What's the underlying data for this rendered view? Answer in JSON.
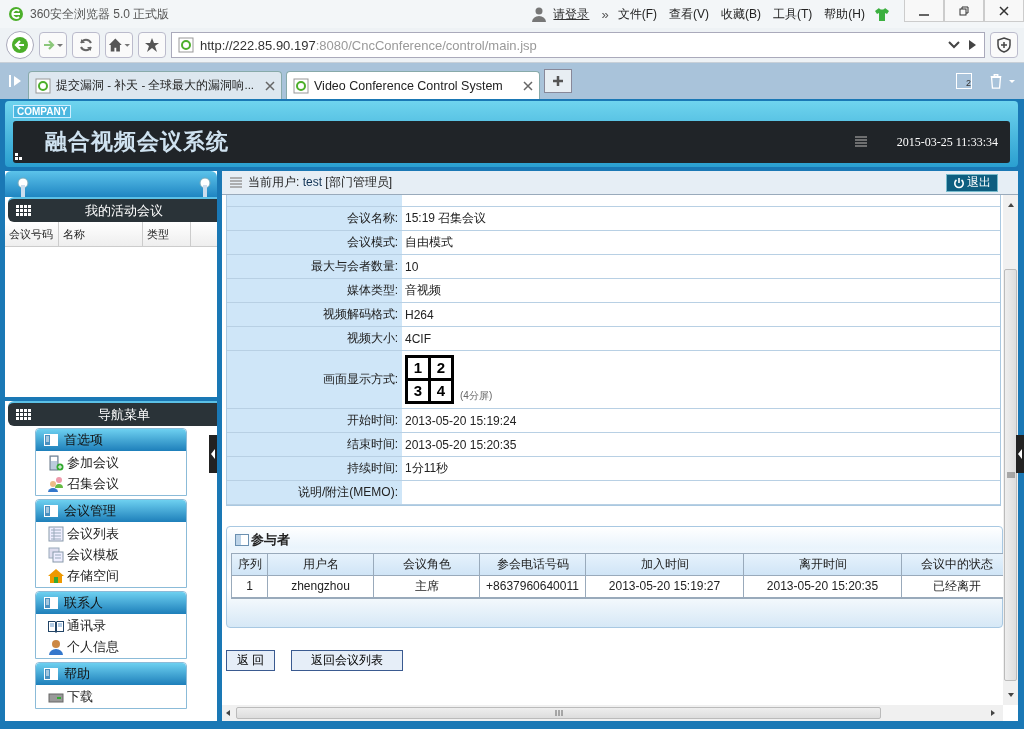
{
  "browser": {
    "title": "360安全浏览器 5.0 正式版",
    "login": "请登录",
    "more": "»",
    "menus": [
      "文件(F)",
      "查看(V)",
      "收藏(B)",
      "工具(T)",
      "帮助(H)"
    ],
    "url_host": "http://222.85.90.197",
    "url_rest": ":8080/CncConference/control/main.jsp",
    "tabs": [
      {
        "label": "提交漏洞 - 补天 - 全球最大的漏洞响...",
        "selected": false
      },
      {
        "label": "Video Conference Control System",
        "selected": true
      }
    ],
    "window_count": "2"
  },
  "app": {
    "company": "COMPANY",
    "title": "融合视频会议系统",
    "datetime": "2015-03-25 11:33:34",
    "user_label": "当前用户:",
    "user": "test",
    "role": "[部门管理员]",
    "logout": "退出"
  },
  "sidebar": {
    "active_title": "我的活动会议",
    "active_columns": [
      "会议号码",
      "名称",
      "类型"
    ],
    "nav_title": "导航菜单",
    "groups": [
      {
        "title": "首选项",
        "items": [
          {
            "label": "参加会议",
            "kind": "phone"
          },
          {
            "label": "召集会议",
            "kind": "people"
          }
        ]
      },
      {
        "title": "会议管理",
        "items": [
          {
            "label": "会议列表",
            "kind": "list"
          },
          {
            "label": "会议模板",
            "kind": "pages"
          },
          {
            "label": "存储空间",
            "kind": "house"
          }
        ]
      },
      {
        "title": "联系人",
        "items": [
          {
            "label": "通讯录",
            "kind": "book"
          },
          {
            "label": "个人信息",
            "kind": "person"
          }
        ]
      },
      {
        "title": "帮助",
        "items": [
          {
            "label": "下载",
            "kind": "drive"
          }
        ]
      }
    ]
  },
  "details": [
    {
      "kind": "text",
      "label": "会议名称:",
      "value": "15:19 召集会议"
    },
    {
      "kind": "text",
      "label": "会议模式:",
      "value": "自由模式"
    },
    {
      "kind": "text",
      "label": "最大与会者数量:",
      "value": "10"
    },
    {
      "kind": "text",
      "label": "媒体类型:",
      "value": "音视频"
    },
    {
      "kind": "text",
      "label": "视频解码格式:",
      "value": "H264"
    },
    {
      "kind": "text",
      "label": "视频大小:",
      "value": "4CIF"
    },
    {
      "kind": "layout",
      "label": "画面显示方式:",
      "cells": [
        "1",
        "2",
        "3",
        "4"
      ],
      "caption": "(4分屏)"
    },
    {
      "kind": "text",
      "label": "开始时间:",
      "value": "2013-05-20 15:19:24"
    },
    {
      "kind": "text",
      "label": "结束时间:",
      "value": "2013-05-20 15:20:35"
    },
    {
      "kind": "text",
      "label": "持续时间:",
      "value": "1分11秒"
    },
    {
      "kind": "text",
      "label": "说明/附注(MEMO):"
    }
  ],
  "participants": {
    "title": "参与者",
    "columns": [
      "序列",
      "用户名",
      "会议角色",
      "参会电话号码",
      "加入时间",
      "离开时间",
      "会议中的状态"
    ],
    "rows": [
      [
        "1",
        "zhengzhou",
        "主席",
        "+8637960640011",
        "2013-05-20 15:19:27",
        "2013-05-20 15:20:35",
        "已经离开"
      ]
    ]
  },
  "buttons": [
    "返 回",
    "返回会议列表"
  ]
}
